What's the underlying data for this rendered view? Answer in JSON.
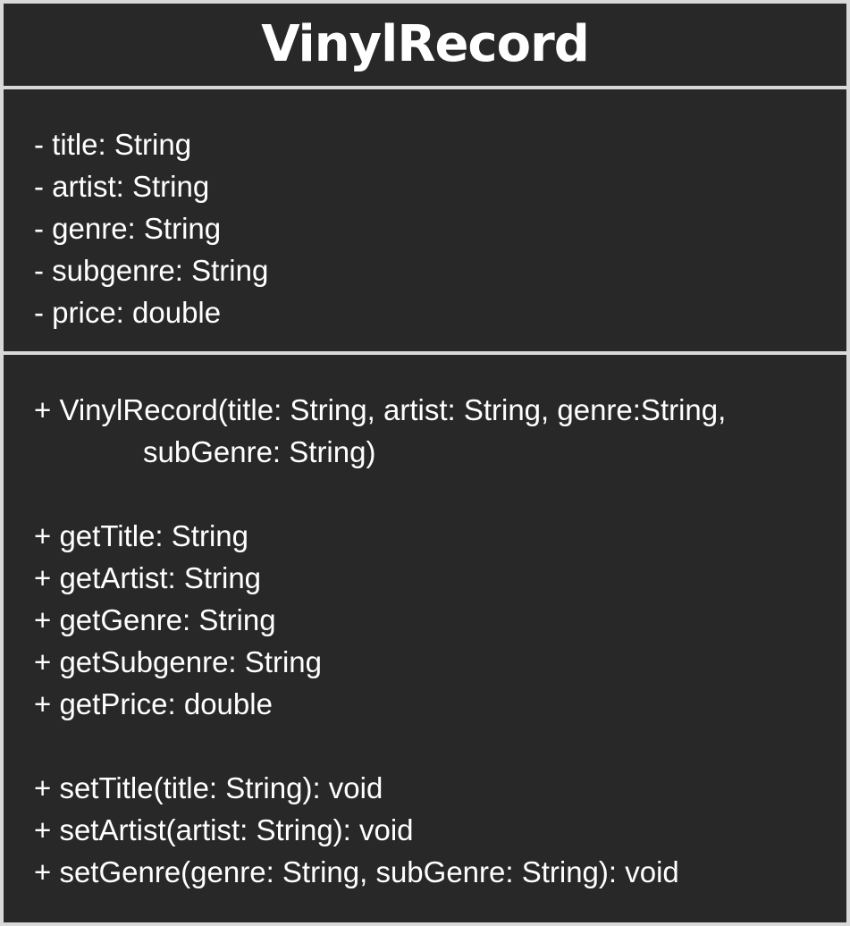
{
  "class_name": "VinylRecord",
  "attributes": [
    "- title: String",
    "- artist: String",
    "- genre: String",
    "- subgenre: String",
    "- price: double"
  ],
  "constructor": {
    "line1": "+ VinylRecord(title: String, artist: String, genre:String,",
    "line2": "subGenre: String)"
  },
  "getters": [
    "+ getTitle: String",
    "+ getArtist: String",
    "+ getGenre: String",
    "+ getSubgenre: String",
    "+ getPrice: double"
  ],
  "setters": [
    "+ setTitle(title: String): void",
    "+ setArtist(artist: String): void",
    "+ setGenre(genre: String, subGenre: String): void"
  ],
  "colors": {
    "border": "#d9d9d9",
    "fill": "#282828",
    "text": "#ffffff"
  }
}
